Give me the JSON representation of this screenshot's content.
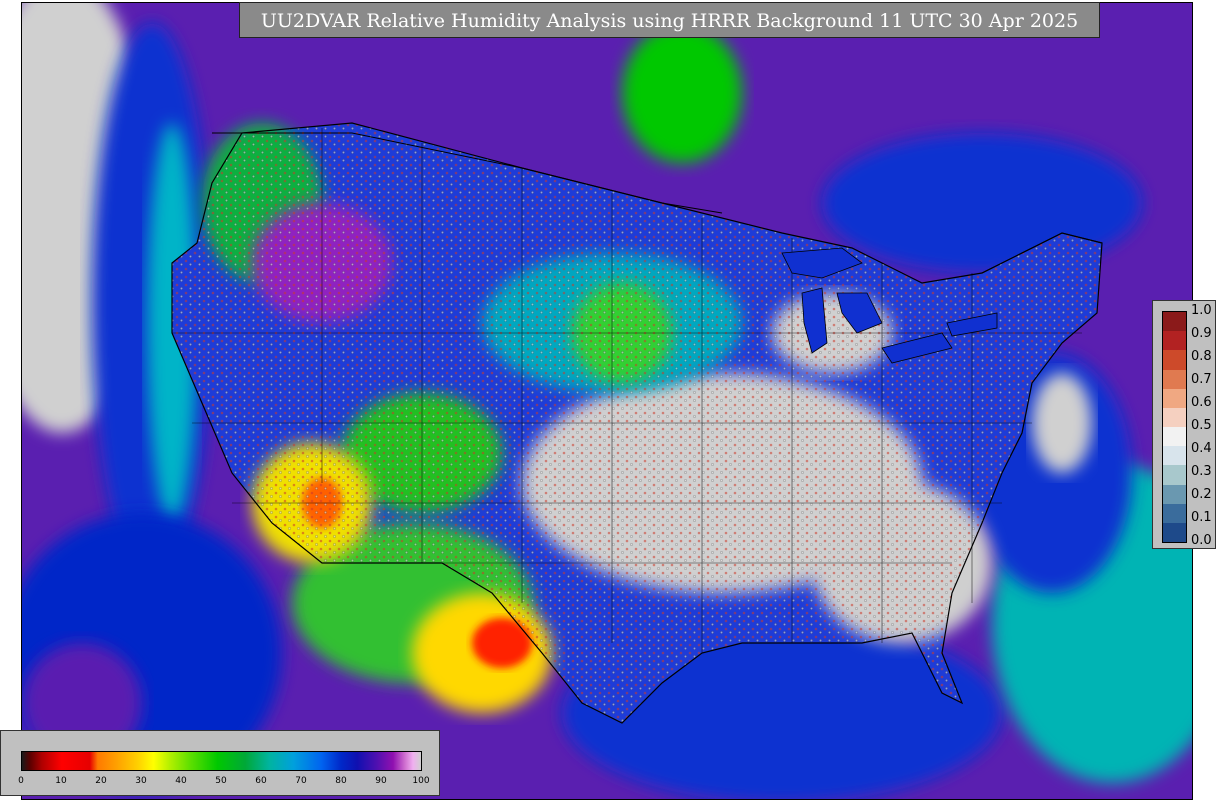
{
  "title": "UU2DVAR Relative Humidity Analysis using HRRR Background 11 UTC 30 Apr 2025",
  "map": {
    "region": "CONUS",
    "colors": {
      "ocean_deep": "#5a1fb0",
      "ocean_blue": "#1030d0",
      "land_missing": "#d0d0d0",
      "humid_green": "#00c800",
      "dry_yellow": "#ffff00",
      "dry_red": "#ff0000",
      "coastline": "#000000"
    }
  },
  "residual_legend": {
    "ticks": [
      "1.0",
      "0.9",
      "0.8",
      "0.7",
      "0.6",
      "0.5",
      "0.4",
      "0.3",
      "0.2",
      "0.1",
      "0.0"
    ],
    "colors": [
      "#8b1a1a",
      "#b22222",
      "#cd4a2a",
      "#e07a50",
      "#f0a882",
      "#f5d0c0",
      "#f2f2f2",
      "#d8e4ec",
      "#a8c8cc",
      "#6a98b0",
      "#3a6c9c",
      "#1e4a8a"
    ]
  },
  "rh_legend": {
    "ticks": [
      "0",
      "10",
      "20",
      "30",
      "40",
      "50",
      "60",
      "70",
      "80",
      "90",
      "100"
    ]
  }
}
